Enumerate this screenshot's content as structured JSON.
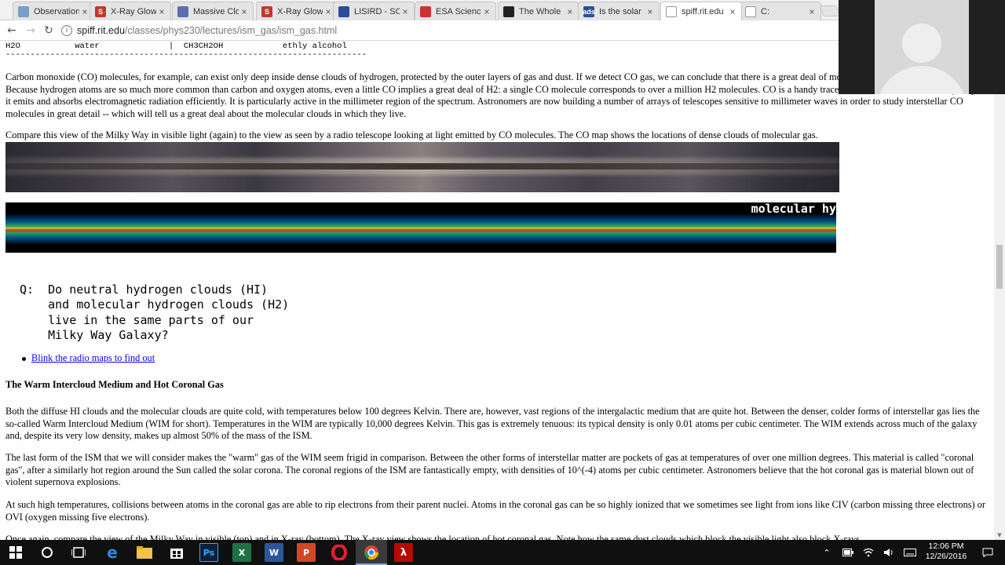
{
  "browser": {
    "tabs": [
      {
        "label": "Observation",
        "fav_color": "#7a9ec9",
        "fav_text": ""
      },
      {
        "label": "X-Ray Glow",
        "fav_color": "#c0392b",
        "fav_text": "S"
      },
      {
        "label": "Massive Clo",
        "fav_color": "#5a6fb0",
        "fav_text": ""
      },
      {
        "label": "X-Ray Glow",
        "fav_color": "#c0392b",
        "fav_text": "S"
      },
      {
        "label": "LISIRD - SO",
        "fav_color": "#2c4d9a",
        "fav_text": ""
      },
      {
        "label": "ESA Science",
        "fav_color": "#d03030",
        "fav_text": ""
      },
      {
        "label": "The Whole",
        "fav_color": "#222222",
        "fav_text": ""
      },
      {
        "label": "Is the solar",
        "fav_color": "#2a4f9a",
        "fav_text": "ads"
      },
      {
        "label": "spiff.rit.edu",
        "fav_color": "#ffffff",
        "fav_text": ""
      },
      {
        "label": "C:",
        "fav_color": "#ffffff",
        "fav_text": ""
      }
    ],
    "active_tab": 8,
    "url_host": "spiff.rit.edu",
    "url_path": "/classes/phys230/lectures/ism_gas/ism_gas.html"
  },
  "page": {
    "table_row": "H2O           water              |  CH3CH2OH            ethly alcohol",
    "table_rule": "-------------------------------------------------------------------------",
    "para_co": "Carbon monoxide (CO) molecules, for example, can exist only deep inside dense clouds of hydrogen, protected by the outer layers of gas and dust. If we detect CO gas, we can conclude that there is a great deal of molecular hydrogen surrounding it. Because hydrogen atoms are so much more common than carbon and oxygen atoms, even a little CO implies a great deal of H2: a single CO molecule corresponds to over a million H2 molecules. CO is a handy tracer because, unlike molecular hydrogen, it emits and absorbs electromagnetic radiation efficiently. It is particularly active in the millimeter region of the spectrum. Astronomers are now building a number of arrays of telescopes sensitive to millimeter waves in order to study interstellar CO molecules in great detail -- which will tell us a great deal about the molecular clouds in which they live.",
    "para_compare": "Compare this view of the Milky Way in visible light (again) to the view as seen by a radio telescope looking at light emitted by CO molecules. The CO map shows the locations of dense clouds of molecular gas.",
    "co_map_label": "molecular hy",
    "question": "Q:  Do neutral hydrogen clouds (HI)\n    and molecular hydrogen clouds (H2)\n    live in the same parts of our\n    Milky Way Galaxy?",
    "blink_link": "Blink the radio maps to find out",
    "section_heading": "The Warm Intercloud Medium and Hot Coronal Gas",
    "para_wim": "Both the diffuse HI clouds and the molecular clouds are quite cold, with temperatures below 100 degrees Kelvin. There are, however, vast regions of the intergalactic medium that are quite hot. Between the denser, colder forms of interstellar gas lies the so-called Warm Intercloud Medium (WIM for short). Temperatures in the WIM are typically 10,000 degrees Kelvin. This gas is extremely tenuous: its typical density is only 0.01 atoms per cubic centimeter. The WIM extends across much of the galaxy and, despite its very low density, makes up almost 50% of the mass of the ISM.",
    "para_coronal": "The last form of the ISM that we will consider makes the \"warm\" gas of the WIM seem frigid in comparison. Between the other forms of interstellar matter are pockets of gas at temperatures of over one million degrees. This material is called \"coronal gas\", after a similarly hot region around the Sun called the solar corona. The coronal regions of the ISM are fantastically empty, with densities of 10^(-4) atoms per cubic centimeter. Astronomers believe that the hot coronal gas is material blown out of violent supernova explosions.",
    "para_ionized": "At such high temperatures, collisions between atoms in the coronal gas are able to rip electrons from their parent nuclei. Atoms in the coronal gas can be so highly ionized that we sometimes see light from ions like CIV (carbon missing three electrons) or OVI (oxygen missing five electrons).",
    "para_xray": "Once again, compare the view of the Milky Way in visible (top) and in X-ray (bottom). The X-ray view shows the location of hot coronal gas. Note how the same dust clouds which block the visible light also block X-rays."
  },
  "taskbar": {
    "time": "12:06 PM",
    "date": "12/26/2016"
  }
}
